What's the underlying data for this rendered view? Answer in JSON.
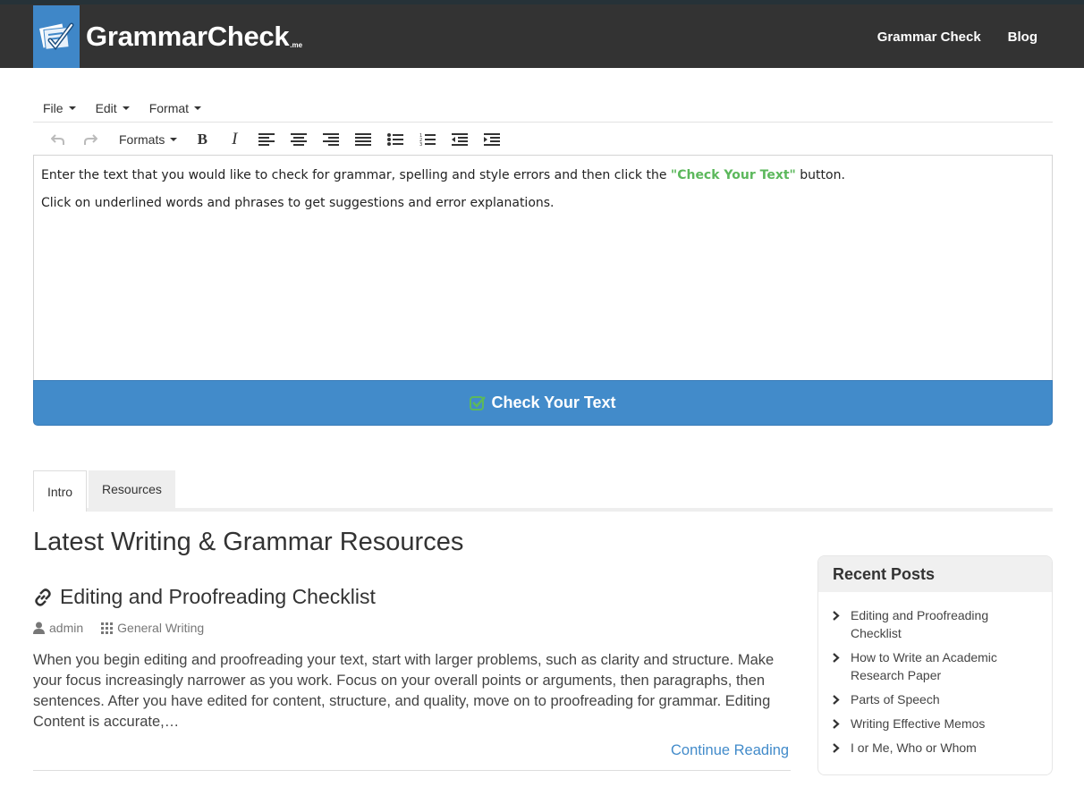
{
  "brand": {
    "name": "GrammarCheck",
    "suffix": ".me"
  },
  "nav": {
    "items": [
      "Grammar Check",
      "Blog"
    ]
  },
  "editor": {
    "menus": [
      "File",
      "Edit",
      "Format"
    ],
    "formats_label": "Formats",
    "content": {
      "line1_before": "Enter the text that you would like to check for grammar, spelling and style errors and then click the ",
      "line1_highlight": "\"Check Your Text\"",
      "line1_after": " button.",
      "line2": "Click on underlined words and phrases to get suggestions and error explanations."
    },
    "check_button_label": "Check Your Text"
  },
  "tabs": [
    {
      "label": "Intro",
      "active": true
    },
    {
      "label": "Resources",
      "active": false
    }
  ],
  "section_title": "Latest Writing & Grammar Resources",
  "post": {
    "title": "Editing and Proofreading Checklist",
    "author": "admin",
    "category": "General Writing",
    "excerpt": "When you begin editing and proofreading your text, start with larger problems, such as clarity and structure. Make your focus increasingly narrower as you work. Focus on your overall points or arguments, then paragraphs, then sentences. After you have edited for content, structure, and quality, move on to proofreading for grammar. Editing Content is accurate,…",
    "continue_label": "Continue Reading"
  },
  "sidebar": {
    "title": "Recent Posts",
    "items": [
      "Editing and Proofreading Checklist",
      "How to Write an Academic Research Paper",
      "Parts of Speech",
      "Writing Effective Memos",
      "I or Me, Who or Whom"
    ]
  },
  "colors": {
    "header_bg": "#333333",
    "brand_blue": "#428bca",
    "highlight_green": "#5cb85c",
    "link_blue": "#428bca"
  }
}
